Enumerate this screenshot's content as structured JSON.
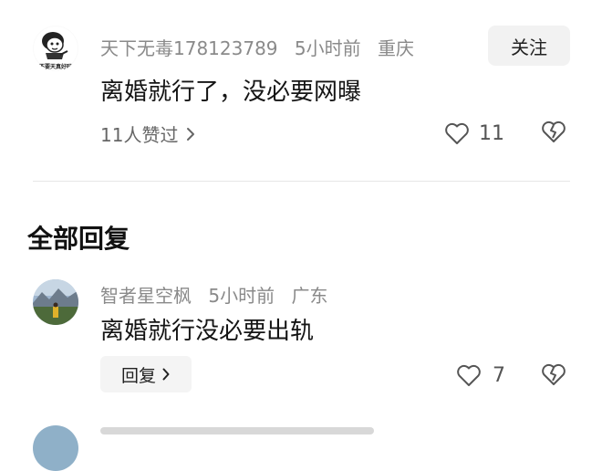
{
  "top_comment": {
    "username": "天下无毒178123789",
    "time": "5小时前",
    "location": "重庆",
    "follow_label": "关注",
    "text": "离婚就行了，没必要网曝",
    "likers_label": "11人赞过",
    "like_count": "11",
    "avatar_caption": "不要天真好吗"
  },
  "section_title": "全部回复",
  "replies": [
    {
      "username": "智者星空枫",
      "time": "5小时前",
      "location": "广东",
      "text": "离婚就行没必要出轨",
      "reply_label": "回复",
      "like_count": "7"
    }
  ],
  "colors": {
    "meta_gray": "#8a8a8a",
    "button_bg": "#f2f2f2",
    "divider": "#e6e6e6"
  }
}
